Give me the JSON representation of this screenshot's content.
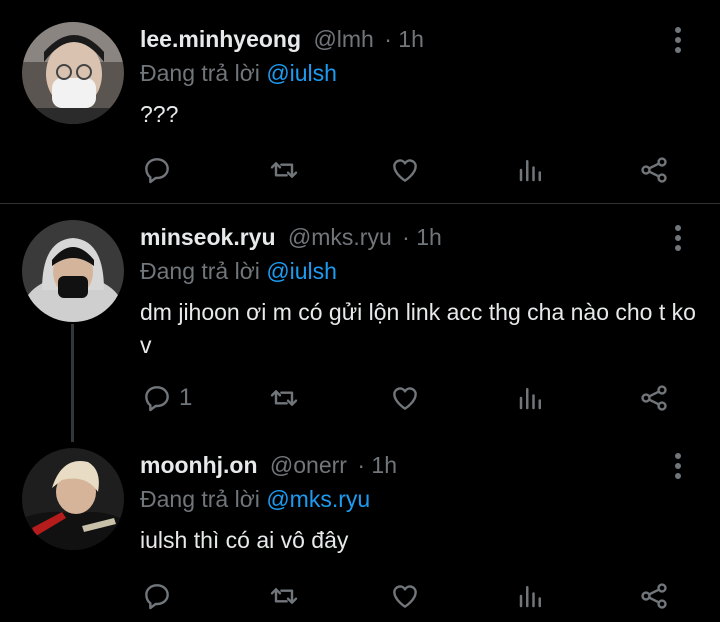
{
  "tweets": [
    {
      "name": "lee.minhyeong",
      "handle": "@lmh",
      "time": "· 1h",
      "reply_prefix": "Đang trả lời",
      "reply_to": "@iulsh",
      "text": "???",
      "reply_count": ""
    },
    {
      "name": "minseok.ryu",
      "handle": "@mks.ryu",
      "time": "· 1h",
      "reply_prefix": "Đang trả lời",
      "reply_to": "@iulsh",
      "text": "dm jihoon ơi m có gửi lộn link acc thg cha nào cho t ko v",
      "reply_count": "1"
    },
    {
      "name": "moonhj.on",
      "handle": "@onerr",
      "time": "· 1h",
      "reply_prefix": "Đang trả lời",
      "reply_to": "@mks.ryu",
      "text": "iulsh thì có ai vô đây",
      "reply_count": ""
    }
  ],
  "icons": [
    "reply-icon",
    "retweet-icon",
    "like-icon",
    "views-icon",
    "share-icon",
    "more-icon"
  ],
  "colors": {
    "background": "#000000",
    "text": "#e7e9ea",
    "muted": "#71767b",
    "accent": "#1d9bf0"
  }
}
